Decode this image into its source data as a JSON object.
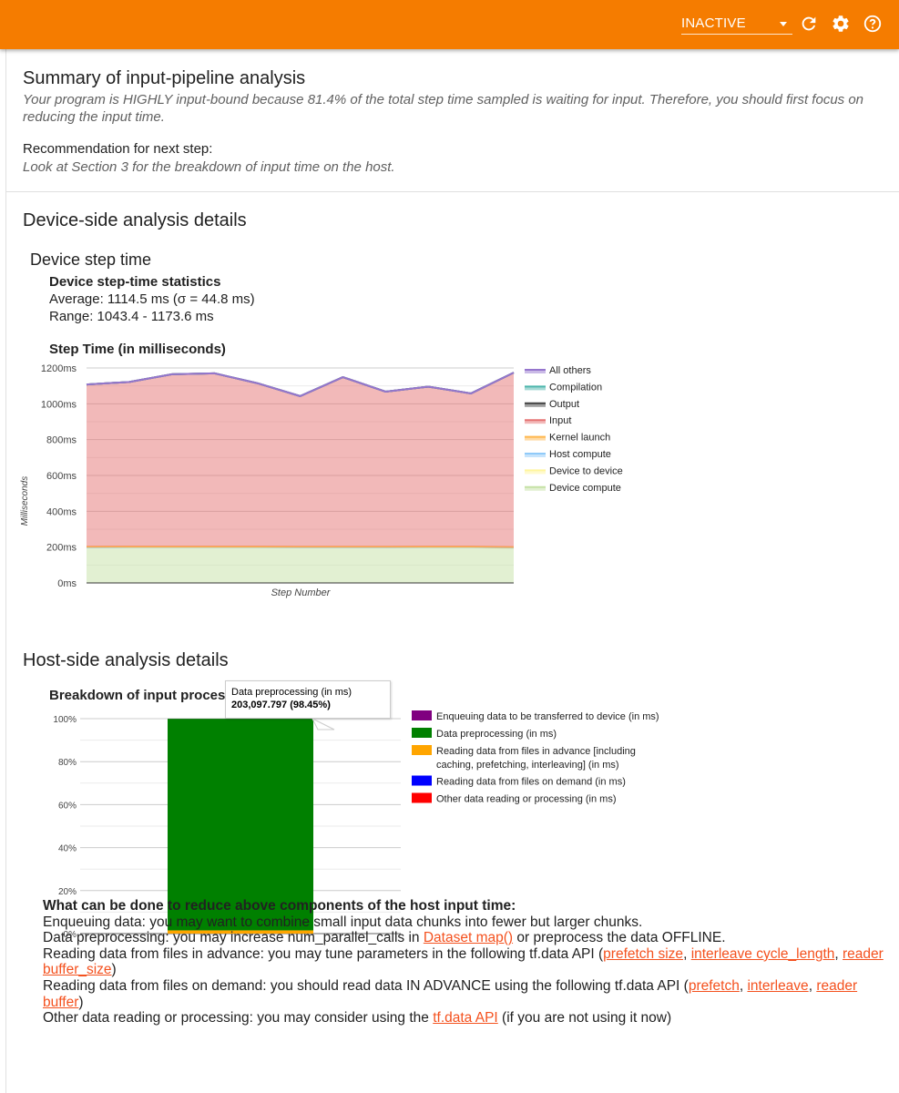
{
  "topbar": {
    "status_value": "INACTIVE",
    "icons": [
      "refresh-icon",
      "gear-icon",
      "help-icon"
    ],
    "background": "#f57c00"
  },
  "summary": {
    "title": "Summary of input-pipeline analysis",
    "text": "Your program is HIGHLY input-bound because 81.4% of the total step time sampled is waiting for input. Therefore, you should first focus on reducing the input time.",
    "rec_label": "Recommendation for next step:",
    "rec_text": "Look at Section 3 for the breakdown of input time on the host."
  },
  "device": {
    "section_title": "Device-side analysis details",
    "sub_title": "Device step time",
    "stats_title": "Device step-time statistics",
    "average": "Average: 1114.5 ms (σ = 44.8 ms)",
    "range": "Range: 1043.4 - 1173.6 ms",
    "chart_title": "Step Time (in milliseconds)"
  },
  "host": {
    "section_title": "Host-side analysis details",
    "chart_title": "Breakdown of input processing time on the host",
    "tooltip_label": "Data preprocessing (in ms)",
    "tooltip_value": "203,097.797 (98.45%)"
  },
  "tips": {
    "heading": "What can be done to reduce above components of the host input time:",
    "enqueue": "Enqueuing data: you may want to combine small input data chunks into fewer but larger chunks.",
    "preproc_pre": "Data preprocessing: you may increase num_parallel_calls in ",
    "preproc_link": "Dataset map()",
    "preproc_post": " or preprocess the data OFFLINE.",
    "advance_pre": "Reading data from files in advance: you may tune parameters in the following tf.data API (",
    "advance_link1": "prefetch size",
    "advance_link2": "interleave cycle_length",
    "advance_link3": "reader buffer_size",
    "demand_pre": "Reading data from files on demand: you should read data IN ADVANCE using the following tf.data API (",
    "demand_link1": "prefetch",
    "demand_link2": "interleave",
    "demand_link3": "reader buffer",
    "other_pre": "Other data reading or processing: you may consider using the ",
    "other_link": "tf.data API",
    "other_post": " (if you are not using it now)",
    "comma": ", ",
    "close": ")"
  },
  "chart_data": [
    {
      "type": "area",
      "stacked": true,
      "title": "Step Time (in milliseconds)",
      "xlabel": "Step Number",
      "ylabel": "Milliseconds",
      "ylim": [
        0,
        1200
      ],
      "yticks": [
        "0ms",
        "200ms",
        "400ms",
        "600ms",
        "800ms",
        "1000ms",
        "1200ms"
      ],
      "ytick_values": [
        0,
        200,
        400,
        600,
        800,
        1000,
        1200
      ],
      "grid": true,
      "legend": "right",
      "x": [
        1,
        2,
        3,
        4,
        5,
        6,
        7,
        8,
        9,
        10,
        11
      ],
      "series": [
        {
          "name": "Device compute",
          "color": "#c5e1a5",
          "values": [
            198,
            199,
            199,
            199,
            199,
            198,
            198,
            198,
            199,
            199,
            196
          ]
        },
        {
          "name": "Device to device",
          "color": "#fff59d",
          "values": [
            0,
            0,
            0,
            0,
            0,
            0,
            0,
            0,
            0,
            0,
            0
          ]
        },
        {
          "name": "Host compute",
          "color": "#90caf9",
          "values": [
            1,
            1,
            1,
            1,
            1,
            1,
            1,
            1,
            1,
            1,
            1
          ]
        },
        {
          "name": "Kernel launch",
          "color": "#ffb74d",
          "values": [
            3,
            3,
            3,
            3,
            3,
            3,
            3,
            3,
            3,
            3,
            3
          ]
        },
        {
          "name": "Input",
          "color": "#e57373",
          "values": [
            906,
            919,
            962,
            967,
            912,
            841,
            947,
            866,
            893,
            855,
            974
          ]
        },
        {
          "name": "Output",
          "color": "#424242",
          "values": [
            0,
            0,
            0,
            0,
            0,
            0,
            0,
            0,
            0,
            0,
            0
          ]
        },
        {
          "name": "Compilation",
          "color": "#4db6ac",
          "values": [
            0,
            0,
            0,
            0,
            0,
            0,
            0,
            0,
            0,
            0,
            0
          ]
        },
        {
          "name": "All others",
          "color": "#9575cd",
          "values": [
            0,
            0,
            0,
            0,
            0,
            0,
            0,
            0,
            0,
            0,
            0
          ]
        }
      ],
      "legend_order": [
        "All others",
        "Compilation",
        "Output",
        "Input",
        "Kernel launch",
        "Host compute",
        "Device to device",
        "Device compute"
      ]
    },
    {
      "type": "bar",
      "stacked": true,
      "percent": true,
      "title": "Breakdown of input processing time on the host",
      "ylim": [
        0,
        100
      ],
      "yticks": [
        "0%",
        "20%",
        "40%",
        "60%",
        "80%",
        "100%"
      ],
      "ytick_values": [
        0,
        20,
        40,
        60,
        80,
        100
      ],
      "grid": true,
      "legend": "right",
      "categories": [
        ""
      ],
      "series": [
        {
          "name": "Other data reading or processing (in ms)",
          "color": "#ff0000",
          "values": [
            0
          ]
        },
        {
          "name": "Reading data from files on demand (in ms)",
          "color": "#0000ff",
          "values": [
            0
          ]
        },
        {
          "name": "Reading data from files in advance [including caching, prefetching, interleaving] (in ms)",
          "color": "#ffa500",
          "values": [
            1.5
          ]
        },
        {
          "name": "Data preprocessing (in ms)",
          "color": "#008000",
          "values": [
            98.45
          ]
        },
        {
          "name": "Enqueuing data to be transferred to device (in ms)",
          "color": "#800080",
          "values": [
            0.05
          ]
        }
      ],
      "legend_order": [
        {
          "label": "Enqueuing data to be transferred to device (in ms)",
          "color": "#800080"
        },
        {
          "label": "Data preprocessing (in ms)",
          "color": "#008000"
        },
        {
          "label": "Reading data from files in advance [including",
          "label2": "caching, prefetching, interleaving] (in ms)",
          "color": "#ffa500"
        },
        {
          "label": "Reading data from files on demand (in ms)",
          "color": "#0000ff"
        },
        {
          "label": "Other data reading or processing (in ms)",
          "color": "#ff0000"
        }
      ]
    }
  ]
}
